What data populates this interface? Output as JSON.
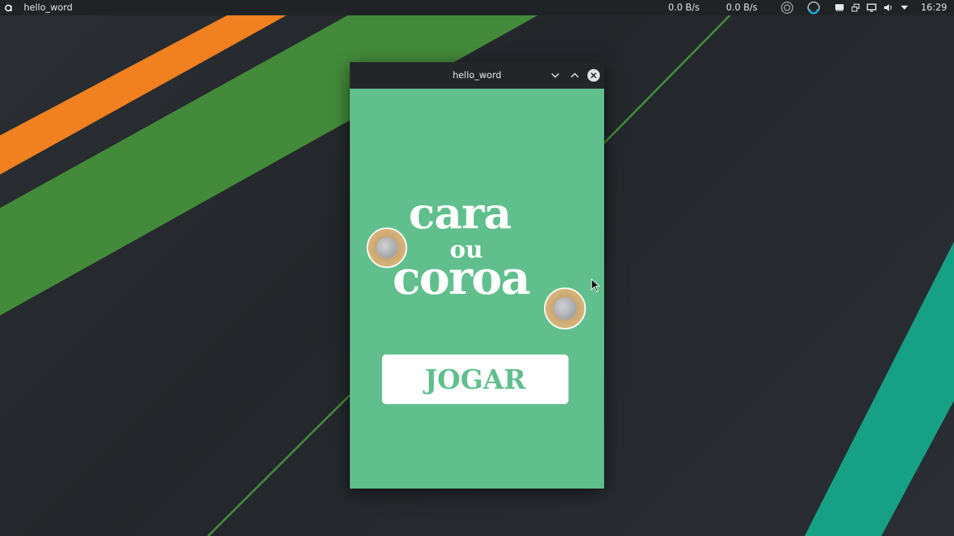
{
  "panel": {
    "launcher_icon": "app-launcher-icon",
    "active_window_title": "hello_word",
    "net_down": "0.0 B/s",
    "net_up": "0.0 B/s",
    "tray_icons": [
      "circle-status-icon",
      "sync-icon",
      "display-icon",
      "network-icon",
      "screen-icon",
      "volume-icon",
      "dropdown-arrow-icon"
    ],
    "clock": "16:29"
  },
  "window": {
    "title": "hello_word",
    "controls": [
      "minimize-icon",
      "maximize-icon",
      "close-icon"
    ]
  },
  "app": {
    "logo": {
      "word1": "cara",
      "word2": "ou",
      "word3": "coroa"
    },
    "play_button_label": "JOGAR"
  },
  "colors": {
    "app_background": "#61bf8d",
    "panel_background": "#1f2326",
    "titlebar_background": "#232629",
    "wallpaper_orange": "#f08020",
    "wallpaper_green": "#438a3b",
    "wallpaper_teal": "#16a085"
  }
}
